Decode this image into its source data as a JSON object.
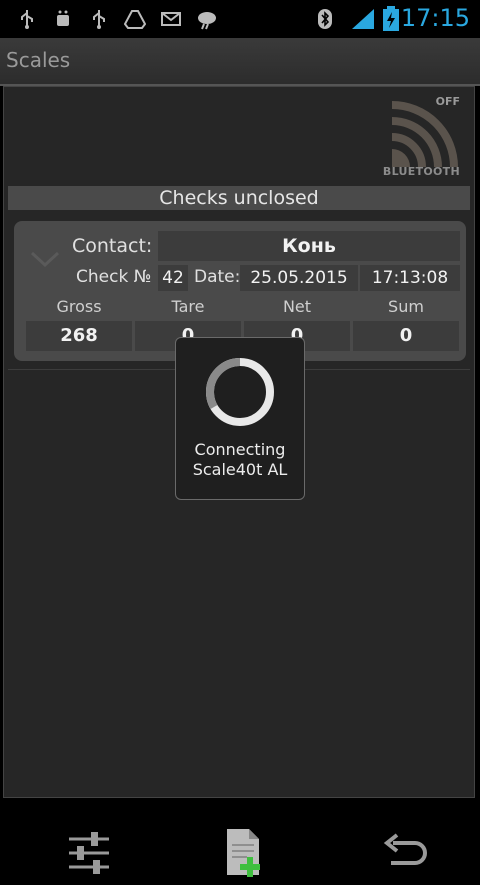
{
  "status_bar": {
    "time": "17:15",
    "icons": [
      "usb-icon",
      "android-debug-icon",
      "usb-icon",
      "drive-icon",
      "mail-icon",
      "weather-icon",
      "bluetooth-icon",
      "signal-icon",
      "battery-charging-icon"
    ]
  },
  "app": {
    "title": "Scales"
  },
  "bluetooth": {
    "state": "OFF",
    "label": "BLUETOOTH"
  },
  "section": {
    "title": "Checks unclosed"
  },
  "check": {
    "contact_label": "Contact:",
    "contact_value": "Конь",
    "check_label": "Check №",
    "check_number": "42",
    "date_label": "Date:",
    "date_value": "25.05.2015",
    "time_value": "17:13:08",
    "headers": [
      "Gross",
      "Tare",
      "Net",
      "Sum"
    ],
    "values": [
      "268",
      "0",
      "0",
      "0"
    ]
  },
  "dialog": {
    "line1": "Connecting",
    "line2": "Scale40t AL"
  },
  "toolbar": {
    "icons": [
      "settings-sliders-icon",
      "add-document-icon",
      "undo-icon"
    ]
  },
  "colors": {
    "accent_time": "#2aa8e0",
    "plus_green": "#3fbf3f"
  }
}
